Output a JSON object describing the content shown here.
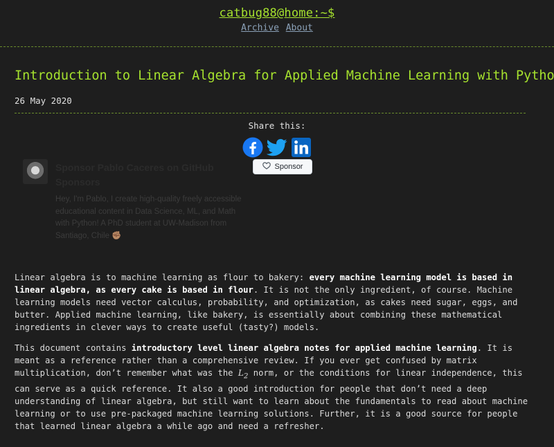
{
  "site": {
    "title": "catbug88@home:~$",
    "nav": [
      "Archive",
      "About"
    ]
  },
  "post": {
    "title": "Introduction to Linear Algebra for Applied Machine Learning with Python",
    "date": "26 May 2020"
  },
  "share": {
    "label": "Share this:",
    "icons": [
      "facebook-icon",
      "twitter-icon",
      "linkedin-icon"
    ],
    "colors": {
      "facebook": "#1877f2",
      "twitter": "#1da1f2",
      "linkedin": "#0a66c2"
    }
  },
  "sponsor": {
    "title": "Sponsor Pablo Caceres on GitHub Sponsors",
    "description": "Hey, I'm Pablo, I create high-quality freely accessible educational content in Data Science, ML, and Math with Python! A PhD student at UW-Madison from Santiago, Chile ✊🏽",
    "button_label": "Sponsor"
  },
  "content": {
    "p1": {
      "a": "Linear algebra is to machine learning as flour to bakery: ",
      "b": "every machine learning model is based in linear algebra, as every cake is based in flour",
      "c": ". It is not the only ingredient, of course. Machine learning models need vector calculus, probability, and optimization, as cakes need sugar, eggs, and butter. Applied machine learning, like bakery, is essentially about combining these mathematical ingredients in clever ways to create useful (tasty?) models."
    },
    "p2": {
      "a": "This document contains ",
      "b": "introductory level linear algebra notes for applied machine learning",
      "c": ". It is meant as a reference rather than a comprehensive review. If you ever get confused by matrix multiplication, don’t remember what was the ",
      "math_l": "L",
      "math_sub": "2",
      "d": " norm, or the conditions for linear independence, this can serve as a quick reference. It also a good introduction for people that don’t need a deep understanding of linear algebra, but still want to learn about the fundamentals to read about machine learning or to use pre-packaged machine learning solutions. Further, it is a good source for people that learned linear algebra a while ago and need a refresher."
    }
  },
  "colors": {
    "background": "#1e1e1e",
    "accent": "#a6e22e",
    "nav_link": "#8ba1b8"
  }
}
